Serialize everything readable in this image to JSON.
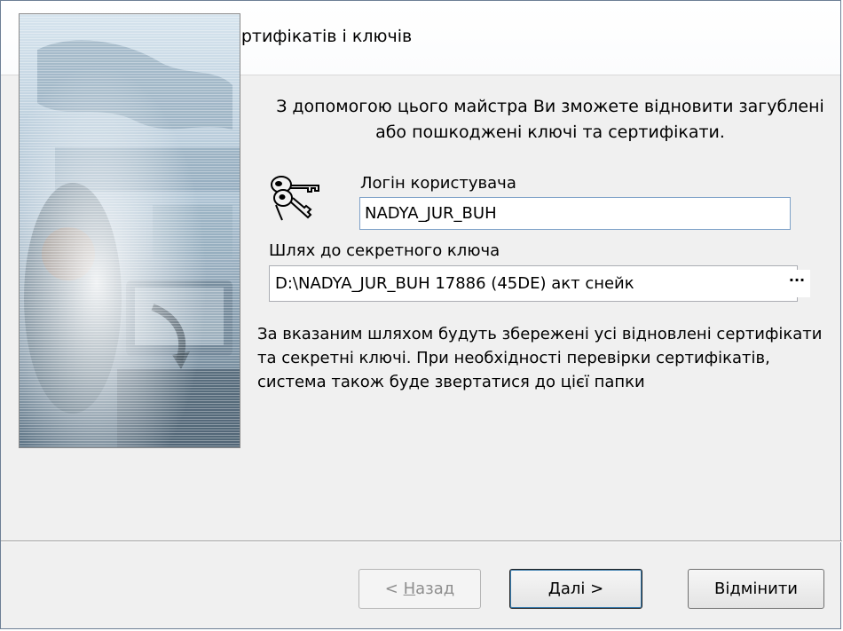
{
  "window": {
    "title": "Майстер відновлення сертифікатів і ключів"
  },
  "intro": {
    "text": "З допомогою цього майстра Ви зможете відновити загублені або пошкоджені ключі та сертифікати."
  },
  "login": {
    "label": "Логін користувача",
    "value": "NADYA_JUR_BUH"
  },
  "path": {
    "label": "Шлях до секретного ключа",
    "value": "D:\\NADYA_JUR_BUH 17886 (45DE) акт снейк",
    "browse_label": "···"
  },
  "description": {
    "text": "За вказаним шляхом будуть збережені усі відновлені сертифікати та секретні ключі. При необхідності перевірки сертифікатів, система також буде звертатися до цієї папки"
  },
  "buttons": {
    "back_prefix": "< ",
    "back_accel": "Н",
    "back_rest": "азад",
    "next_accel": "Д",
    "next_rest": "алі >",
    "cancel": "Відмінити"
  },
  "icons": {
    "keys": "keys-icon"
  }
}
